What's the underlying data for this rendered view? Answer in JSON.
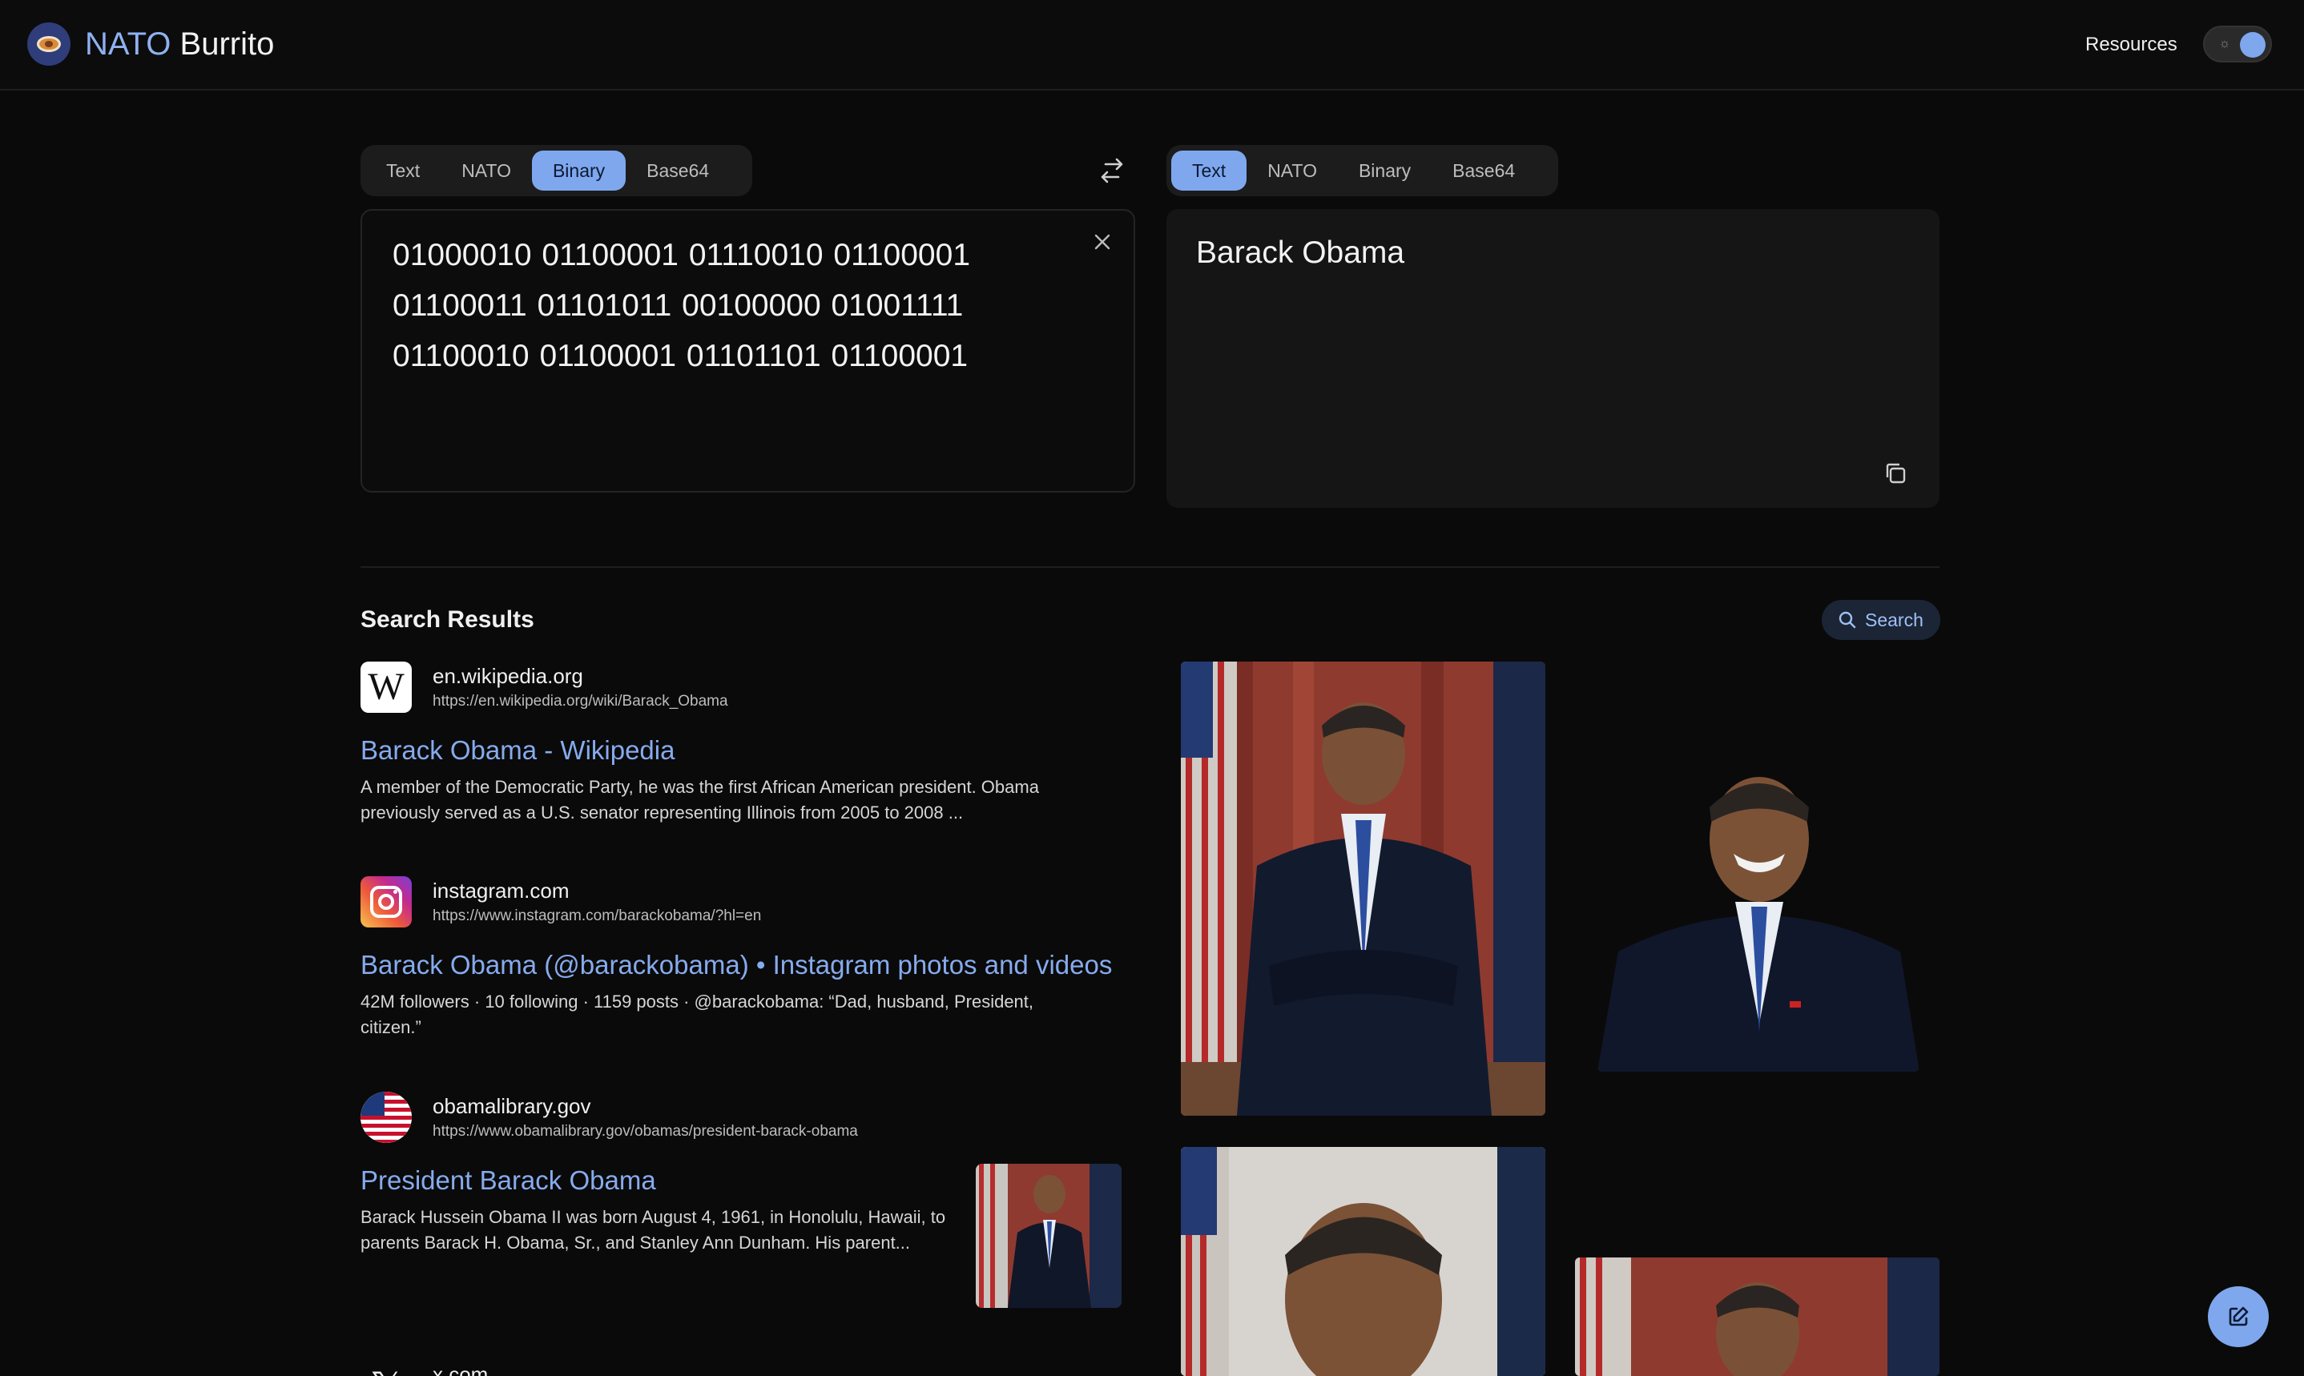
{
  "app": {
    "brand_first": "NATO",
    "brand_second": "Burrito"
  },
  "header": {
    "resources_label": "Resources"
  },
  "input_tabs": [
    {
      "label": "Text",
      "active": false
    },
    {
      "label": "NATO",
      "active": false
    },
    {
      "label": "Binary",
      "active": true
    },
    {
      "label": "Base64",
      "active": false
    }
  ],
  "output_tabs": [
    {
      "label": "Text",
      "active": true
    },
    {
      "label": "NATO",
      "active": false
    },
    {
      "label": "Binary",
      "active": false
    },
    {
      "label": "Base64",
      "active": false
    }
  ],
  "input": {
    "value": "01000010 01100001 01110010 01100001 01100011 01101011 00100000 01001111 01100010 01100001 01101101 01100001"
  },
  "output": {
    "value": "Barack Obama"
  },
  "search": {
    "title": "Search Results",
    "button_label": "Search",
    "results": [
      {
        "domain": "en.wikipedia.org",
        "url": "https://en.wikipedia.org/wiki/Barack_Obama",
        "title": "Barack Obama - Wikipedia",
        "snippet": "A member of the Democratic Party, he was the first African American president. Obama previously served as a U.S. senator representing Illinois from 2005 to 2008 ...",
        "icon": "wikipedia-icon"
      },
      {
        "domain": "instagram.com",
        "url": "https://www.instagram.com/barackobama/?hl=en",
        "title": "Barack Obama (@barackobama) • Instagram photos and videos",
        "snippet": "42M followers · 10 following · 1159 posts · @barackobama: “Dad, husband, President, citizen.”",
        "icon": "instagram-icon"
      },
      {
        "domain": "obamalibrary.gov",
        "url": "https://www.obamalibrary.gov/obamas/president-barack-obama",
        "title": "President Barack Obama",
        "snippet": "Barack Hussein Obama II was born August 4, 1961, in Honolulu, Hawaii, to parents Barack H. Obama, Sr., and Stanley Ann Dunham. His parent...",
        "icon": "us-flag-icon"
      },
      {
        "domain": "x.com",
        "icon": "x-icon"
      }
    ]
  },
  "colors": {
    "accent": "#7ea7ee",
    "link": "#86abee",
    "background": "#0a0a0a"
  }
}
